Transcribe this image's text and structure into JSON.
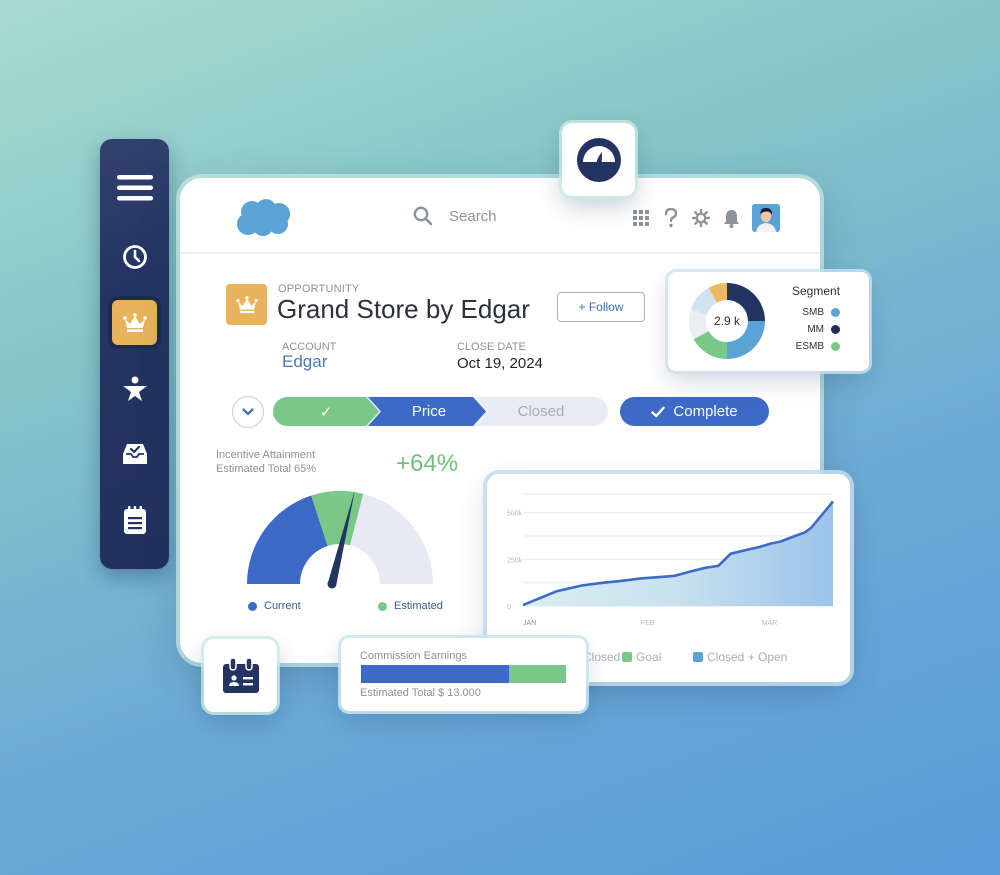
{
  "nav_rail": {
    "items": [
      {
        "name": "menu",
        "icon": "hamburger-menu-icon"
      },
      {
        "name": "recent",
        "icon": "clock-icon"
      },
      {
        "name": "opportunities",
        "icon": "crown-icon",
        "active": true
      },
      {
        "name": "accessibility",
        "icon": "person-star-icon"
      },
      {
        "name": "inbox",
        "icon": "inbox-check-icon"
      },
      {
        "name": "notes",
        "icon": "clipboard-list-icon"
      }
    ]
  },
  "header": {
    "logo": "cloud-logo",
    "search_placeholder": "Search",
    "icons": [
      "app-launcher-grid-icon",
      "help-icon",
      "settings-gear-icon",
      "notifications-bell-icon"
    ],
    "avatar": "user-avatar"
  },
  "record": {
    "object_type": "OPPORTUNITY",
    "title": "Grand Store by Edgar",
    "follow_label": "+ Follow",
    "account_label": "ACCOUNT",
    "account_value": "Edgar",
    "close_date_label": "CLOSE DATE",
    "close_date_value": "Oct 19, 2024"
  },
  "path": {
    "stages": [
      {
        "label": "✓",
        "state": "completed"
      },
      {
        "label": "Price",
        "state": "current"
      },
      {
        "label": "Closed",
        "state": "upcoming"
      }
    ],
    "complete_button": "Complete"
  },
  "incentive": {
    "title_line1": "Incentive Attainment",
    "title_line2": "Estimated Total 65%",
    "delta": "+64%",
    "legend": [
      "Current",
      "Estimated"
    ],
    "current_fraction": 0.4,
    "estimated_fraction": 0.58,
    "needle_fraction": 0.55
  },
  "segment_card": {
    "center_label": "2.9 k",
    "title": "Segment",
    "legend": [
      {
        "label": "SMB",
        "color": "#5ba3d4"
      },
      {
        "label": "MM",
        "color": "#1f2d58"
      },
      {
        "label": "ESMB",
        "color": "#7ac887"
      }
    ],
    "slices": [
      {
        "segment": "MM",
        "share": 0.25,
        "color": "#243462"
      },
      {
        "segment": "SMB",
        "share": 0.25,
        "color": "#5ba3d4"
      },
      {
        "segment": "ESMB",
        "share": 0.17,
        "color": "#7ac887"
      },
      {
        "segment": "Other",
        "share": 0.13,
        "color": "#eceef6"
      },
      {
        "segment": "Other",
        "share": 0.12,
        "color": "#cfe4f0"
      },
      {
        "segment": "Other",
        "share": 0.08,
        "color": "#ecb95e"
      }
    ]
  },
  "chart_data": {
    "type": "area",
    "title": "",
    "xlabel": "",
    "ylabel": "",
    "x_ticks": [
      "JAN",
      "FEB",
      "MAR"
    ],
    "y_ticks": [
      "0",
      "250k",
      "500k"
    ],
    "ylim": [
      0,
      600000
    ],
    "grid": true,
    "legend": [
      {
        "label": "Closed",
        "color": "#3d6ac6",
        "partially_hidden": true
      },
      {
        "label": "Goal",
        "color": "#7ac887"
      },
      {
        "label": "Closed + Open",
        "color": "#5ba3d4"
      }
    ],
    "series": [
      {
        "name": "Closed + Open",
        "x": [
          0,
          0.11,
          0.19,
          0.26,
          0.32,
          0.38,
          0.44,
          0.49,
          0.54,
          0.59,
          0.63,
          0.67,
          0.72,
          0.76,
          0.8,
          0.83,
          0.87,
          0.91,
          0.93,
          0.97,
          1.0
        ],
        "values": [
          5000,
          80000,
          110000,
          125000,
          135000,
          148000,
          155000,
          162000,
          185000,
          205000,
          215000,
          280000,
          300000,
          315000,
          335000,
          345000,
          370000,
          395000,
          420000,
          500000,
          560000
        ]
      }
    ]
  },
  "commission": {
    "title": "Commission Earnings",
    "current_fraction": 0.72,
    "total_label": "Estimated Total $ 13.000"
  },
  "colors": {
    "primary_blue": "#3d6ac6",
    "green": "#7ac887",
    "navy": "#243462",
    "gold": "#e8b35a"
  }
}
